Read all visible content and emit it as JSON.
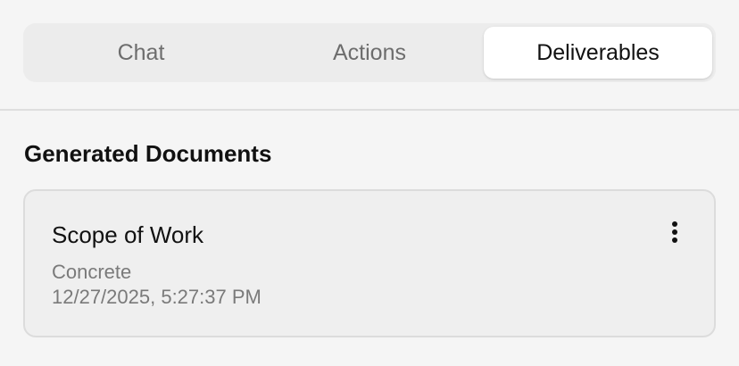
{
  "tabs": [
    {
      "label": "Chat",
      "active": false
    },
    {
      "label": "Actions",
      "active": false
    },
    {
      "label": "Deliverables",
      "active": true
    }
  ],
  "section": {
    "title": "Generated Documents"
  },
  "documents": [
    {
      "title": "Scope of Work",
      "category": "Concrete",
      "timestamp": "12/27/2025, 5:27:37 PM",
      "menu_icon": "more-vertical-icon"
    }
  ],
  "colors": {
    "background": "#f5f5f5",
    "tab_track": "#ececec",
    "tab_active": "#ffffff",
    "card_background": "#efefef",
    "card_border": "#dcdcdc",
    "muted_text": "#7a7a7a"
  }
}
